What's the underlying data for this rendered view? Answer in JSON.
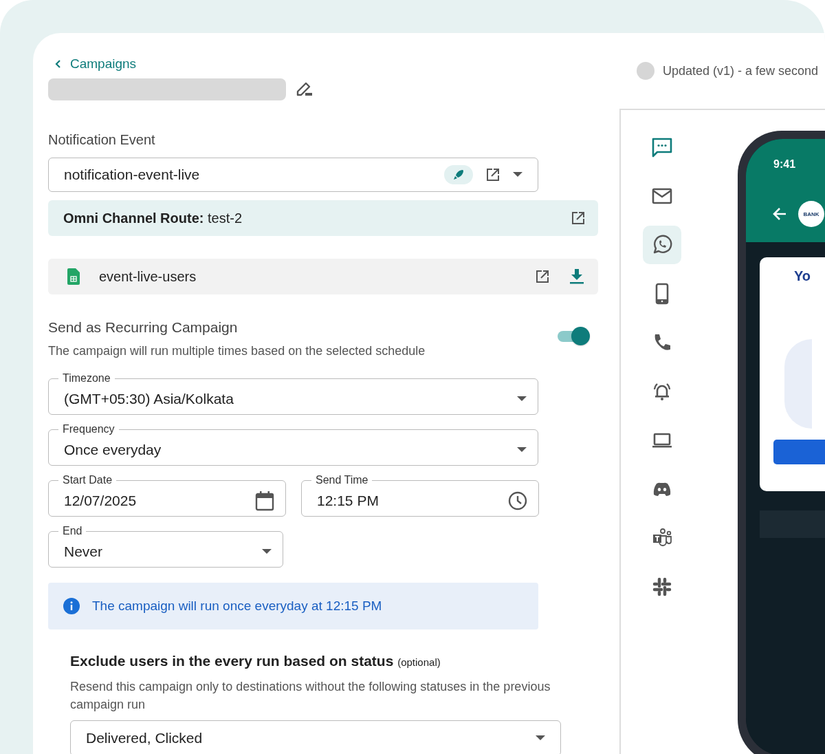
{
  "breadcrumb": {
    "label": "Campaigns"
  },
  "status": {
    "text": "Updated (v1) - a few second"
  },
  "notification_event": {
    "label": "Notification Event",
    "value": "notification-event-live",
    "live": true
  },
  "route": {
    "label": "Omni Channel Route:",
    "value": "test-2"
  },
  "file": {
    "name": "event-live-users"
  },
  "recurring": {
    "title": "Send as Recurring Campaign",
    "description": "The campaign will run multiple times based on the selected schedule",
    "on": true
  },
  "fields": [
    {
      "kind": "select",
      "label": "Timezone",
      "value": "(GMT+05:30) Asia/Kolkata"
    },
    {
      "kind": "select",
      "label": "Frequency",
      "value": "Once everyday"
    },
    {
      "kind": "date",
      "label": "Start Date",
      "value": "12/07/2025"
    },
    {
      "kind": "time",
      "label": "Send Time",
      "value": "12:15 PM"
    },
    {
      "kind": "select",
      "label": "End",
      "value": "Never"
    }
  ],
  "info": {
    "text": "The campaign will run once everyday at 12:15 PM"
  },
  "exclude": {
    "title": "Exclude users in the every run based on status",
    "optional": "(optional)",
    "description": "Resend this campaign only to destinations without the following statuses in the previous campaign run",
    "value": "Delivered, Clicked"
  },
  "channels": [
    {
      "kind": "sms",
      "active": true,
      "selected": false
    },
    {
      "kind": "email",
      "active": false,
      "selected": false
    },
    {
      "kind": "whatsapp",
      "active": false,
      "selected": true
    },
    {
      "kind": "mobile",
      "active": false,
      "selected": false
    },
    {
      "kind": "voice",
      "active": false,
      "selected": false
    },
    {
      "kind": "alert",
      "active": false,
      "selected": false
    },
    {
      "kind": "web",
      "active": false,
      "selected": false
    },
    {
      "kind": "discord",
      "active": false,
      "selected": false
    },
    {
      "kind": "teams",
      "active": false,
      "selected": false
    },
    {
      "kind": "slack",
      "active": false,
      "selected": false
    }
  ],
  "phone": {
    "time": "9:41",
    "avatar": "BANK",
    "message_title": "Yo"
  }
}
